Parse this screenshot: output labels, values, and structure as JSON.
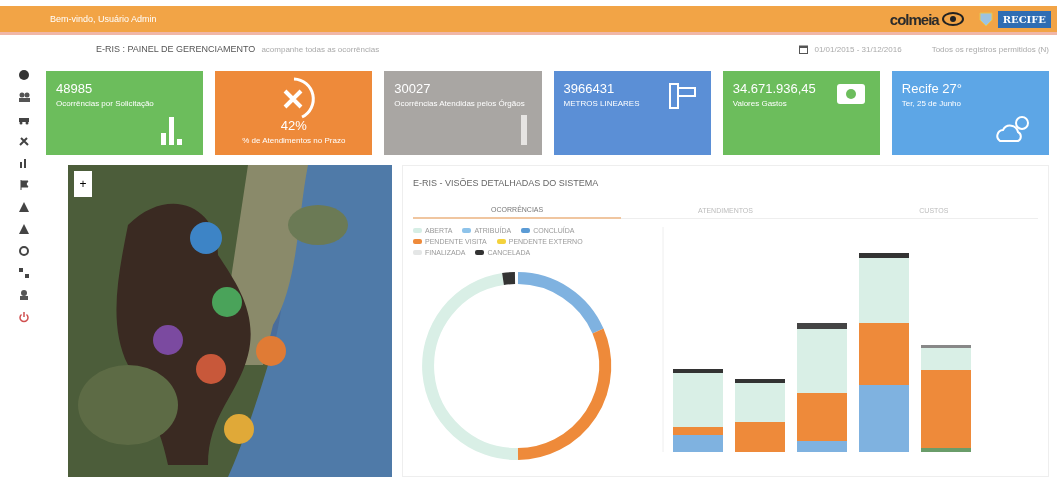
{
  "top_bar": {
    "user": "Bem-vindo, Usuário Admin",
    "brand": "colmeia",
    "city_badge": "RECIFE"
  },
  "header": {
    "title": "E-RIS : PAINEL DE GERENCIAMENTO",
    "subtitle": "acompanhe todas as ocorrências",
    "date_range": "01/01/2015 - 31/12/2016",
    "filter": "Todos os registros permitidos (N)"
  },
  "cards": [
    {
      "kind": "bars",
      "value": "48985",
      "label": "Ocorrências por Solicitação",
      "color": "#6cbd5c"
    },
    {
      "kind": "gauge",
      "value": "42%",
      "label": "% de Atendimentos no Prazo",
      "color": "#ee8a3a"
    },
    {
      "kind": "thin",
      "value": "30027",
      "label": "Ocorrências Atendidas pelos Órgãos",
      "color": "#a9a6a3"
    },
    {
      "kind": "meter",
      "value": "3966431",
      "label": "METROS LINEARES",
      "color": "#5b8fd6"
    },
    {
      "kind": "money",
      "value": "34.671.936,45",
      "label": "Valores Gastos",
      "color": "#6cbd5c"
    },
    {
      "kind": "weather",
      "value": "Recife 27°",
      "label": "Ter, 25 de Junho",
      "color": "#5da6e6"
    }
  ],
  "map": {
    "zoom_label": "+"
  },
  "panel": {
    "title": "E-RIS - VISÕES DETALHADAS DO SISTEMA",
    "tabs": [
      {
        "label": "OCORRÊNCIAS",
        "selected": true
      },
      {
        "label": "ATENDIMENTOS",
        "selected": false
      },
      {
        "label": "CUSTOS",
        "selected": false
      }
    ],
    "legend": [
      {
        "label": "ABERTA",
        "color": "#d6eee5"
      },
      {
        "label": "ATRIBUÍDA",
        "color": "#8ec3ea"
      },
      {
        "label": "CONCLUÍDA",
        "color": "#5b9bd5"
      },
      {
        "label": "PENDENTE VISITA",
        "color": "#ee8a3a"
      },
      {
        "label": "PENDENTE EXTERNO",
        "color": "#f4d23c"
      },
      {
        "label": "FINALIZADA",
        "color": "#e4e6e6"
      },
      {
        "label": "CANCELADA",
        "color": "#333333"
      }
    ]
  }
}
